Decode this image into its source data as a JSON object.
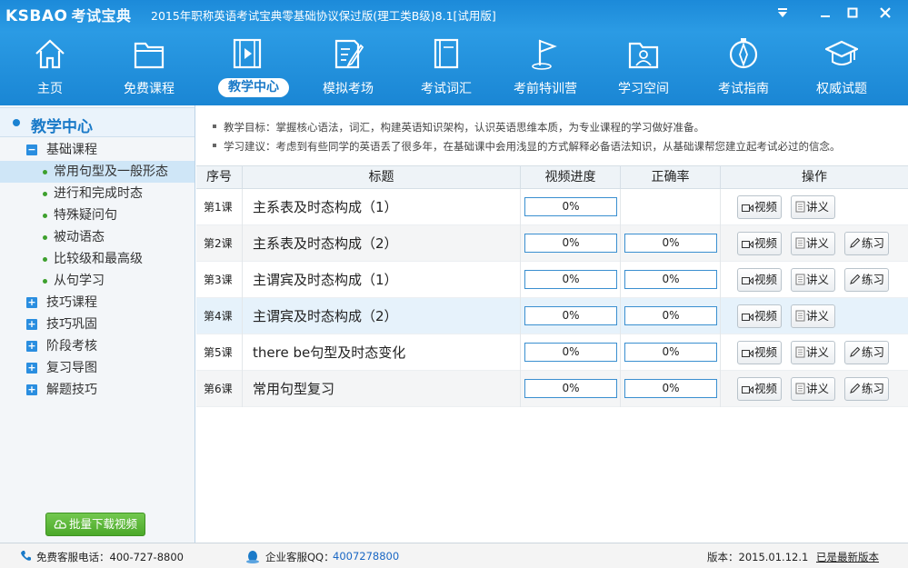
{
  "window": {
    "logo_en": "KSBAO",
    "logo_cn": "考试宝典",
    "title": "2015年职称英语考试宝典零基础协议保过版(理工类B级)8.1[试用版]"
  },
  "nav": [
    {
      "label": "主页",
      "icon": "home-icon"
    },
    {
      "label": "免费课程",
      "icon": "folder-icon"
    },
    {
      "label": "教学中心",
      "icon": "video-icon",
      "active": true
    },
    {
      "label": "模拟考场",
      "icon": "exam-paper-icon"
    },
    {
      "label": "考试词汇",
      "icon": "book-icon"
    },
    {
      "label": "考前特训营",
      "icon": "flag-icon"
    },
    {
      "label": "学习空间",
      "icon": "user-folder-icon"
    },
    {
      "label": "考试指南",
      "icon": "compass-icon"
    },
    {
      "label": "权威试题",
      "icon": "graduation-cap-icon"
    }
  ],
  "sidebar": {
    "header": "教学中心",
    "basic": "基础课程",
    "items": [
      "常用句型及一般形态",
      "进行和完成时态",
      "特殊疑问句",
      "被动语态",
      "比较级和最高级",
      "从句学习"
    ],
    "groups": [
      "技巧课程",
      "技巧巩固",
      "阶段考核",
      "复习导图",
      "解题技巧"
    ],
    "download": "批量下载视频"
  },
  "tips": {
    "goal": "教学目标：掌握核心语法，词汇，构建英语知识架构，认识英语思维本质，为专业课程的学习做好准备。",
    "advice": "学习建议：考虑到有些同学的英语丢了很多年，在基础课中会用浅显的方式解释必备语法知识，从基础课帮您建立起考试必过的信念。"
  },
  "table": {
    "headers": {
      "no": "序号",
      "title": "标题",
      "progress": "视频进度",
      "rate": "正确率",
      "ops": "操作"
    },
    "rows": [
      {
        "no": "第1课",
        "title": "主系表及时态构成（1）",
        "progress": "0%",
        "rate": "",
        "practice": false
      },
      {
        "no": "第2课",
        "title": "主系表及时态构成（2）",
        "progress": "0%",
        "rate": "0%",
        "practice": true
      },
      {
        "no": "第3课",
        "title": "主谓宾及时态构成（1）",
        "progress": "0%",
        "rate": "0%",
        "practice": true
      },
      {
        "no": "第4课",
        "title": "主谓宾及时态构成（2）",
        "progress": "0%",
        "rate": "0%",
        "practice": false
      },
      {
        "no": "第5课",
        "title": "there be句型及时态变化",
        "progress": "0%",
        "rate": "0%",
        "practice": true
      },
      {
        "no": "第6课",
        "title": "常用句型复习",
        "progress": "0%",
        "rate": "0%",
        "practice": true
      }
    ],
    "btn_video": "视频",
    "btn_notes": "讲义",
    "btn_practice": "练习"
  },
  "status": {
    "phone": "免费客服电话：400-727-8800",
    "qq_label": "企业客服QQ：",
    "qq": "4007278800",
    "version": "版本：2015.01.12.1",
    "latest": "已是最新版本"
  }
}
